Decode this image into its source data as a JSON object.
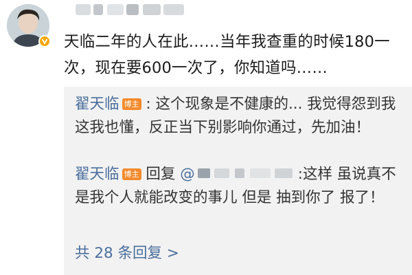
{
  "post": {
    "avatar_icon": "user-avatar-icon",
    "verified_icon": "verified-badge-icon",
    "comment_text": "天临二年的人在此……当年我查重的时候180一次，现在要600一次了，你知道吗……"
  },
  "replies": [
    {
      "author": "翟天临",
      "badge": "博主",
      "separator": ":",
      "text": "这个现象是不健康的... 我觉得怨到我这我也懂，反正当下别影响你通过，先加油！"
    },
    {
      "author": "翟天临",
      "badge": "博主",
      "reply_label": "回复",
      "mention_prefix": "@",
      "separator": ":",
      "text": "这样 虽说真不是我个人就能改变的事儿 但是 抽到你了 报了！"
    }
  ],
  "more_replies_label": "共 28 条回复 >",
  "colors": {
    "link": "#4a6e9c",
    "badge": "#f38a2c",
    "reply_bg": "#f2f2f2",
    "verified": "#f7a600"
  }
}
